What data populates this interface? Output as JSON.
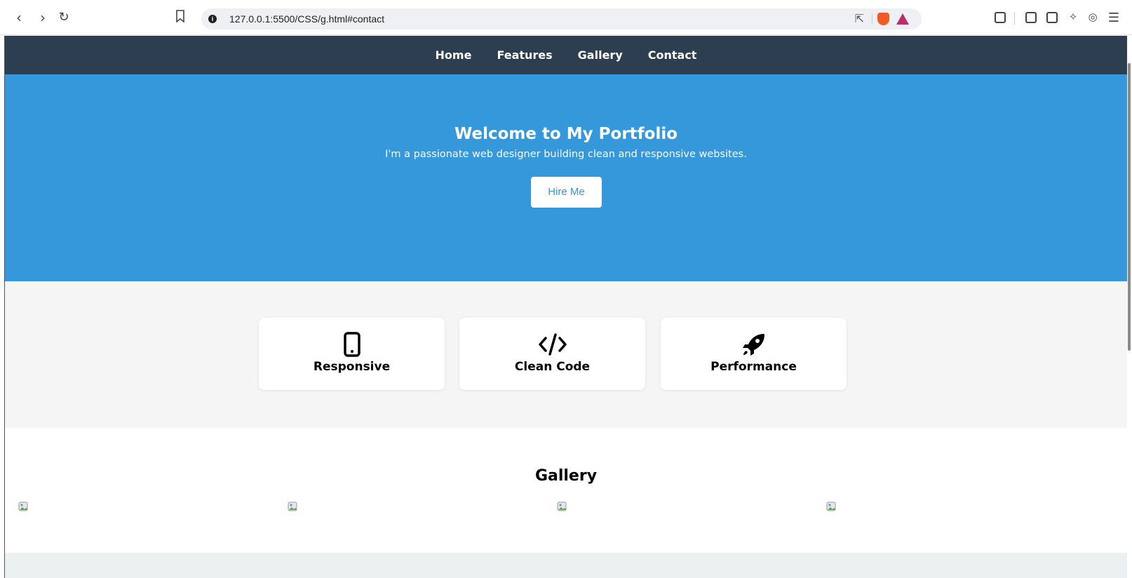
{
  "browser": {
    "url": "127.0.0.1:5500/CSS/g.html#contact",
    "icons": [
      "back-icon",
      "forward-icon",
      "reload-icon",
      "bookmark-icon",
      "site-info-icon",
      "share-icon",
      "brave-shields-icon",
      "brave-rewards-icon",
      "reader-mode-icon",
      "sidebar-icon",
      "wallet-icon",
      "leo-ai-icon",
      "vpn-icon",
      "menu-icon"
    ]
  },
  "nav": {
    "items": [
      {
        "label": "Home"
      },
      {
        "label": "Features"
      },
      {
        "label": "Gallery"
      },
      {
        "label": "Contact"
      }
    ],
    "bg": "#2c3e50"
  },
  "hero": {
    "title": "Welcome to My Portfolio",
    "subtitle": "I'm a passionate web designer building clean and responsive websites.",
    "cta": "Hire Me",
    "bg": "#3498db"
  },
  "features": {
    "cards": [
      {
        "label": "Responsive",
        "icon": "mobile-icon"
      },
      {
        "label": "Clean Code",
        "icon": "code-icon"
      },
      {
        "label": "Performance",
        "icon": "rocket-icon"
      }
    ]
  },
  "gallery": {
    "title": "Gallery",
    "images": 4
  }
}
